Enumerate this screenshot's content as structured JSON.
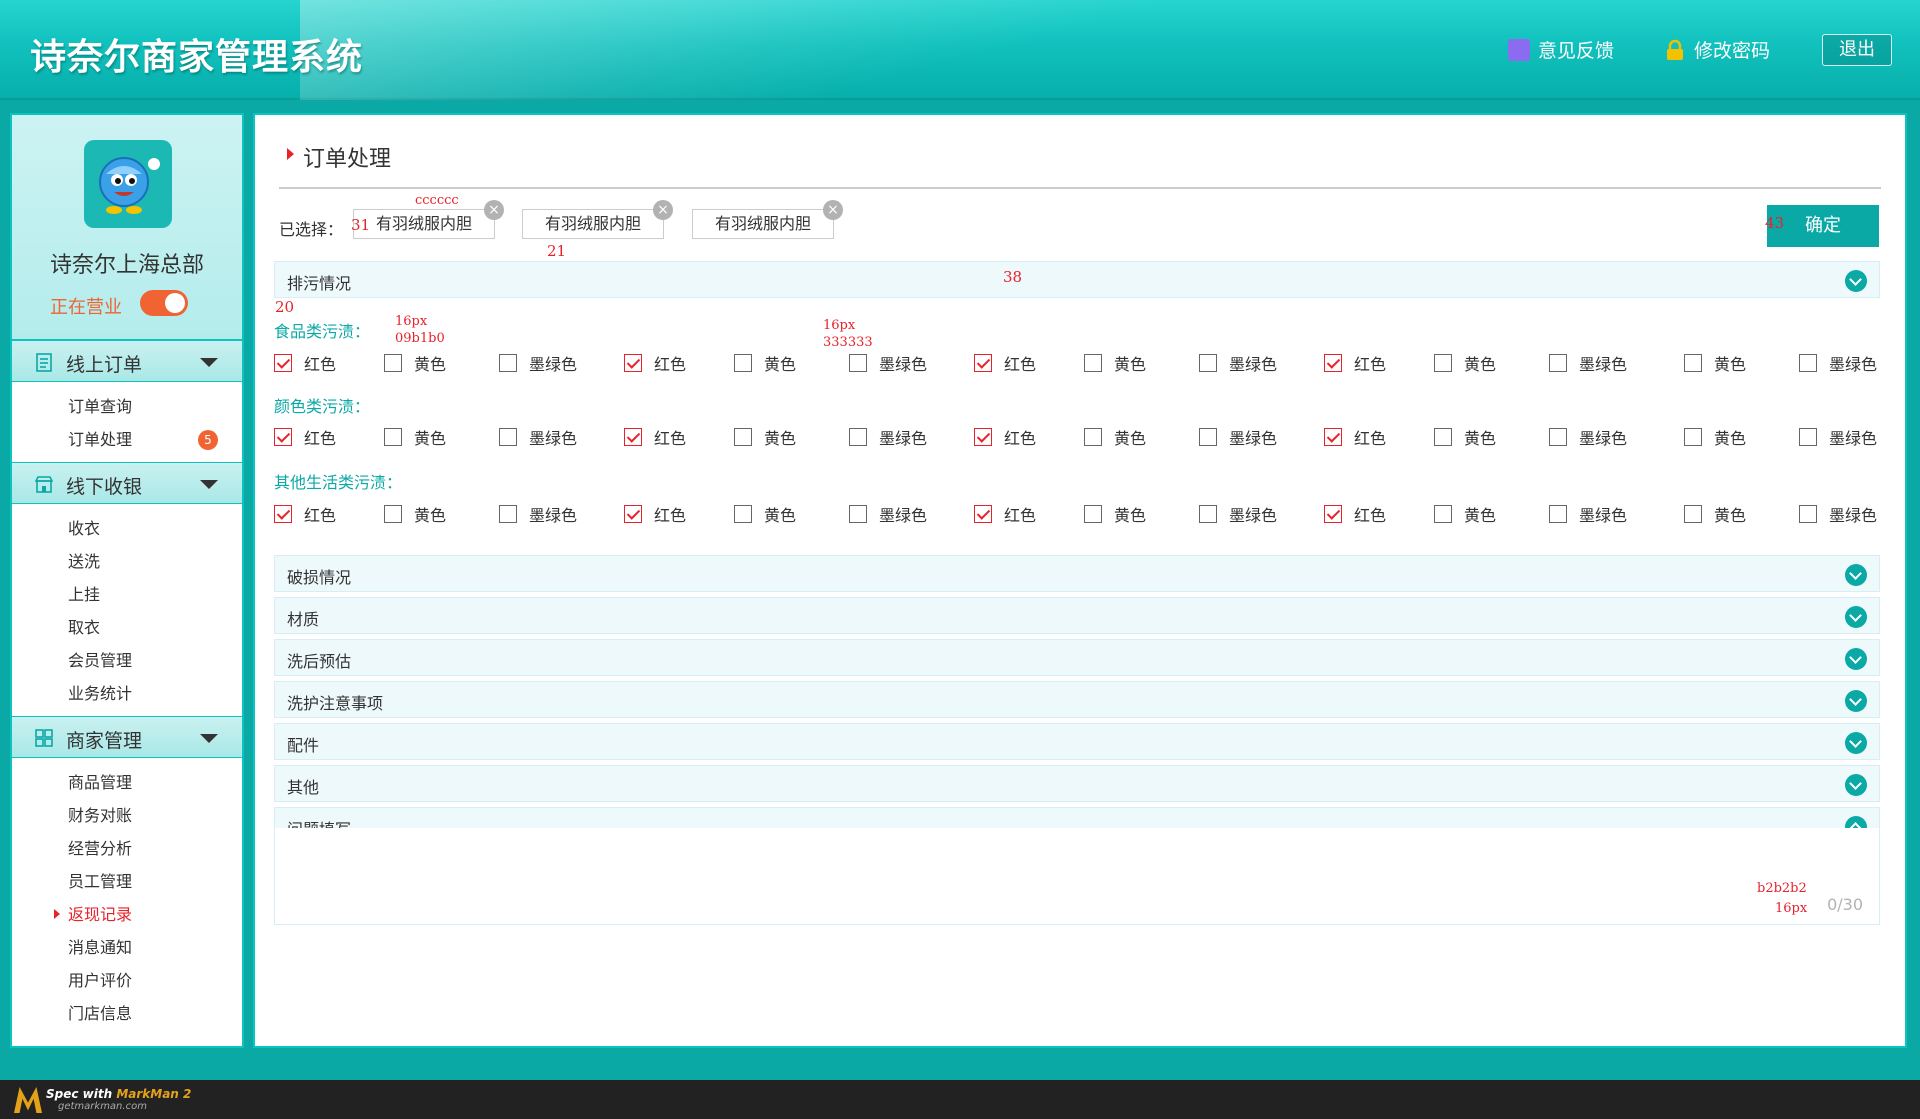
{
  "header": {
    "app_title": "诗奈尔商家管理系统",
    "feedback_label": "意见反馈",
    "password_label": "修改密码",
    "logout_label": "退出"
  },
  "sidebar": {
    "store_name": "诗奈尔上海总部",
    "status_text": "正在营业",
    "toggle_on": true,
    "sections": [
      {
        "label": "线上订单",
        "icon": "clipboard-icon",
        "items": [
          {
            "label": "订单查询"
          },
          {
            "label": "订单处理",
            "badge": "5"
          }
        ]
      },
      {
        "label": "线下收银",
        "icon": "store-icon",
        "items": [
          {
            "label": "收衣"
          },
          {
            "label": "送洗"
          },
          {
            "label": "上挂"
          },
          {
            "label": "取衣"
          },
          {
            "label": "会员管理"
          },
          {
            "label": "业务统计"
          }
        ]
      },
      {
        "label": "商家管理",
        "icon": "grid-icon",
        "items": [
          {
            "label": "商品管理"
          },
          {
            "label": "财务对账"
          },
          {
            "label": "经营分析"
          },
          {
            "label": "员工管理"
          },
          {
            "label": "返现记录",
            "active": true
          },
          {
            "label": "消息通知"
          },
          {
            "label": "用户评价"
          },
          {
            "label": "门店信息"
          }
        ]
      }
    ]
  },
  "main": {
    "page_title": "订单处理",
    "selected_label": "已选择：",
    "chips": [
      "有羽绒服内胆",
      "有羽绒服内胆",
      "有羽绒服内胆"
    ],
    "confirm_label": "确定",
    "accordions": {
      "stain": "排污情况",
      "damage": "破损情况",
      "material": "材质",
      "estimate": "洗后预估",
      "care": "洗护注意事项",
      "accessories": "配件",
      "other": "其他",
      "problem": "问题填写"
    },
    "categories": [
      "食品类污渍：",
      "颜色类污渍：",
      "其他生活类污渍："
    ],
    "options": [
      {
        "label": "红色",
        "checked": true
      },
      {
        "label": "黄色",
        "checked": false
      },
      {
        "label": "墨绿色",
        "checked": false
      },
      {
        "label": "红色",
        "checked": true
      },
      {
        "label": "黄色",
        "checked": false
      },
      {
        "label": "墨绿色",
        "checked": false
      },
      {
        "label": "红色",
        "checked": true
      },
      {
        "label": "黄色",
        "checked": false
      },
      {
        "label": "墨绿色",
        "checked": false
      },
      {
        "label": "红色",
        "checked": true
      },
      {
        "label": "黄色",
        "checked": false
      },
      {
        "label": "墨绿色",
        "checked": false
      },
      {
        "label": "黄色",
        "checked": false
      },
      {
        "label": "墨绿色",
        "checked": false
      }
    ],
    "char_count": "0/30"
  },
  "annotations": {
    "chip_color": "cccccc",
    "chip_height": "31",
    "chip_gap": "21",
    "accordion_height": "38",
    "confirm_height": "43",
    "indent": "20",
    "cat_size": "16px",
    "cat_color": "09b1b0",
    "opt_size": "16px",
    "opt_color": "333333",
    "count_color": "b2b2b2",
    "count_size": "16px"
  },
  "footer": {
    "spec_with": "Spec with ",
    "markman": "MarkMan 2",
    "site": "getmarkman.com"
  },
  "colors": {
    "accent": "#0aa9a6",
    "status": "#f06434",
    "active": "#e8222b",
    "chip_border": "#cccccc"
  }
}
